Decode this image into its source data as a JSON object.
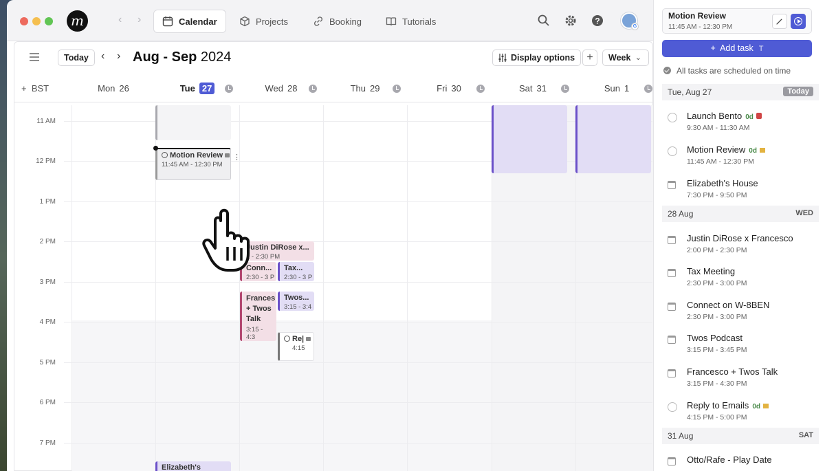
{
  "topbar": {
    "logo": "m",
    "tabs": [
      {
        "label": "Calendar",
        "active": true,
        "icon": "calendar-icon"
      },
      {
        "label": "Projects",
        "active": false,
        "icon": "cube-icon"
      },
      {
        "label": "Booking",
        "active": false,
        "icon": "link-icon"
      },
      {
        "label": "Tutorials",
        "active": false,
        "icon": "book-icon"
      }
    ]
  },
  "calendar": {
    "today_label": "Today",
    "month_bold": "Aug - Sep",
    "year": "2024",
    "display_options_label": "Display options",
    "view_label": "Week",
    "timezone": "BST",
    "days": [
      {
        "name": "Mon",
        "num": "26"
      },
      {
        "name": "Tue",
        "num": "27",
        "today": true
      },
      {
        "name": "Wed",
        "num": "28"
      },
      {
        "name": "Thu",
        "num": "29"
      },
      {
        "name": "Fri",
        "num": "30"
      },
      {
        "name": "Sat",
        "num": "31"
      },
      {
        "name": "Sun",
        "num": "1"
      }
    ],
    "hours": [
      "11 AM",
      "12 PM",
      "1 PM",
      "2 PM",
      "3 PM",
      "4 PM",
      "5 PM",
      "6 PM",
      "7 PM"
    ],
    "events": {
      "motion_review": {
        "title": "Motion Review",
        "time": "11:45 AM - 12:30 PM"
      },
      "justin": {
        "title": "Justin DiRose x...",
        "time": "2 - 2:30 PM"
      },
      "conn": {
        "title": "Conn...",
        "time": "2:30 - 3 P"
      },
      "tax": {
        "title": "Tax...",
        "time": "2:30 - 3 P"
      },
      "frances": {
        "title": "Frances + Twos Talk",
        "time": "3:15 - 4:3"
      },
      "twos": {
        "title": "Twos...",
        "time": "3:15 - 3:4"
      },
      "reply": {
        "title": "Re|",
        "time": "4:15"
      },
      "elizabeth": {
        "title": "Elizabeth's"
      }
    }
  },
  "sidebar": {
    "current": {
      "title": "Motion Review",
      "time": "11:45 AM - 12:30 PM"
    },
    "add_task_label": "Add task",
    "add_task_shortcut": "T",
    "status": "All tasks are scheduled on time",
    "groups": [
      {
        "date": "Tue, Aug 27",
        "right": "Today"
      },
      {
        "date": "28 Aug",
        "right": "WED"
      },
      {
        "date": "31 Aug",
        "right": "SAT"
      }
    ],
    "items": [
      {
        "title": "Launch Bento",
        "due": "0d",
        "time": "9:30 AM - 11:30 AM"
      },
      {
        "title": "Motion Review",
        "due": "0d",
        "time": "11:45 AM - 12:30 PM"
      },
      {
        "title": "Elizabeth's House",
        "time": "7:30 PM - 9:50 PM"
      },
      {
        "title": "Justin DiRose x Francesco",
        "time": "2:00 PM - 2:30 PM"
      },
      {
        "title": "Tax Meeting",
        "time": "2:30 PM - 3:00 PM"
      },
      {
        "title": "Connect on W-8BEN",
        "time": "2:30 PM - 3:00 PM"
      },
      {
        "title": "Twos Podcast",
        "time": "3:15 PM - 3:45 PM"
      },
      {
        "title": "Francesco + Twos Talk",
        "time": "3:15 PM - 4:30 PM"
      },
      {
        "title": "Reply to Emails",
        "due": "0d",
        "time": "4:15 PM - 5:00 PM"
      },
      {
        "title": "Otto/Rafe - Play Date"
      }
    ]
  }
}
